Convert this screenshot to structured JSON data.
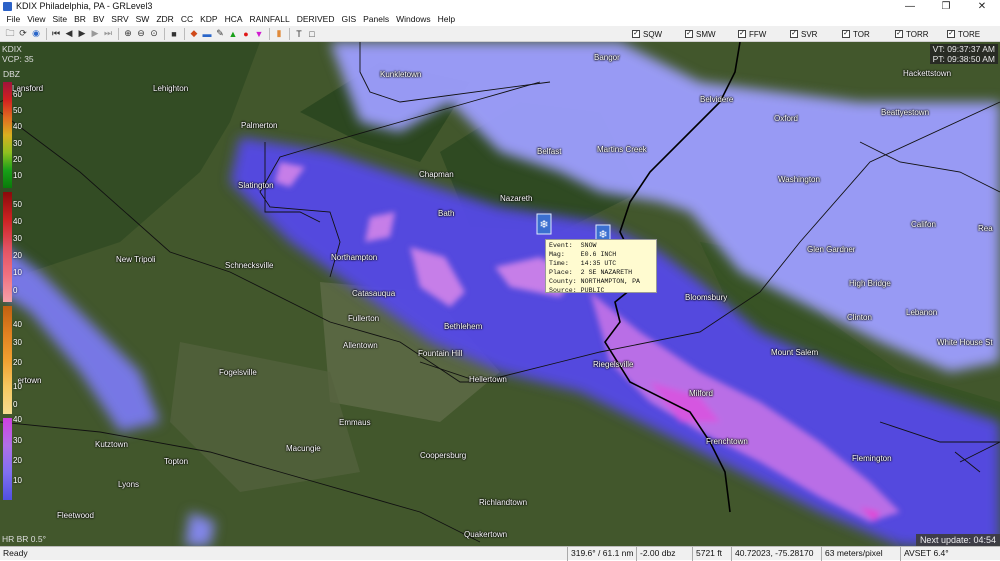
{
  "window": {
    "title": "KDIX Philadelphia, PA - GRLevel3"
  },
  "menu": [
    "File",
    "View",
    "Site",
    "BR",
    "BV",
    "SRV",
    "SW",
    "ZDR",
    "CC",
    "KDP",
    "HCA",
    "RAINFALL",
    "DERIVED",
    "GIS",
    "Panels",
    "Windows",
    "Help"
  ],
  "warnings": [
    "SQW",
    "SMW",
    "FFW",
    "SVR",
    "TOR",
    "TORR",
    "TORE"
  ],
  "overlay": {
    "site": "KDIX",
    "vcp": "VCP: 35",
    "vt": "VT: 09:37:37 AM",
    "pt": "PT: 09:38:50 AM",
    "dbz_label": "DBZ",
    "product": "HR BR 0.5°",
    "next_update": "Next update: 04:54"
  },
  "scale_top": [
    "60",
    "50",
    "40",
    "30",
    "20",
    "10"
  ],
  "scale_mid": [
    "50",
    "40",
    "30",
    "20",
    "10",
    "0"
  ],
  "scale_bot": [
    "40",
    "30",
    "20",
    "10",
    "0"
  ],
  "scale_low": [
    "40",
    "30",
    "20",
    "10"
  ],
  "cities": [
    {
      "name": "Bangor"
    },
    {
      "name": "Hackettstown"
    },
    {
      "name": "Kunkletown"
    },
    {
      "name": "Lehighton"
    },
    {
      "name": "Lansford"
    },
    {
      "name": "Belvidere"
    },
    {
      "name": "Palmerton"
    },
    {
      "name": "Oxford"
    },
    {
      "name": "Beattyestown"
    },
    {
      "name": "Belfast"
    },
    {
      "name": "Martins Creek"
    },
    {
      "name": "Chapman"
    },
    {
      "name": "Washington"
    },
    {
      "name": "Slatington"
    },
    {
      "name": "Nazareth"
    },
    {
      "name": "Bath"
    },
    {
      "name": "Califon"
    },
    {
      "name": "Glen Gardner"
    },
    {
      "name": "New Tripoli"
    },
    {
      "name": "Schnecksville"
    },
    {
      "name": "Northampton"
    },
    {
      "name": "High Bridge"
    },
    {
      "name": "Catasauqua"
    },
    {
      "name": "Bloomsbury"
    },
    {
      "name": "Lebanon"
    },
    {
      "name": "Fullerton"
    },
    {
      "name": "Clinton"
    },
    {
      "name": "Bethlehem"
    },
    {
      "name": "White House St"
    },
    {
      "name": "Allentown"
    },
    {
      "name": "Fountain Hill"
    },
    {
      "name": "Mount Salem"
    },
    {
      "name": "Riegelsville"
    },
    {
      "name": "Fogelsville"
    },
    {
      "name": "Hellertown"
    },
    {
      "name": "Trexlertown"
    },
    {
      "name": "Milford"
    },
    {
      "name": "Emmaus"
    },
    {
      "name": "Frenchtown"
    },
    {
      "name": "Kutztown"
    },
    {
      "name": "Macungie"
    },
    {
      "name": "Coopersburg"
    },
    {
      "name": "Flemington"
    },
    {
      "name": "Topton"
    },
    {
      "name": "Lyons"
    },
    {
      "name": "Richlandtown"
    },
    {
      "name": "Fleetwood"
    },
    {
      "name": "Quakertown"
    },
    {
      "name": "Rea"
    }
  ],
  "popup": {
    "text": "Event:  SNOW\nMag:    E0.6 INCH\nTime:   14:35 UTC\nPlace:  2 SE NAZARETH\nCounty: NORTHAMPTON, PA\nSource: PUBLIC"
  },
  "status": {
    "ready": "Ready",
    "azran": "319.6° / 61.1 nm",
    "value": "-2.00 dbz",
    "height": "5721 ft",
    "coords": "40.72023, -75.28170",
    "res": "63 meters/pixel",
    "tilt": "AVSET 6.4°"
  },
  "colors": {
    "echo_light": "#8a8cff",
    "echo_dark": "#5047e6",
    "echo_pink": "#c57ee6",
    "echo_bright": "#e046d6",
    "terrain": "#3f5429",
    "forest": "#2e4a22"
  }
}
